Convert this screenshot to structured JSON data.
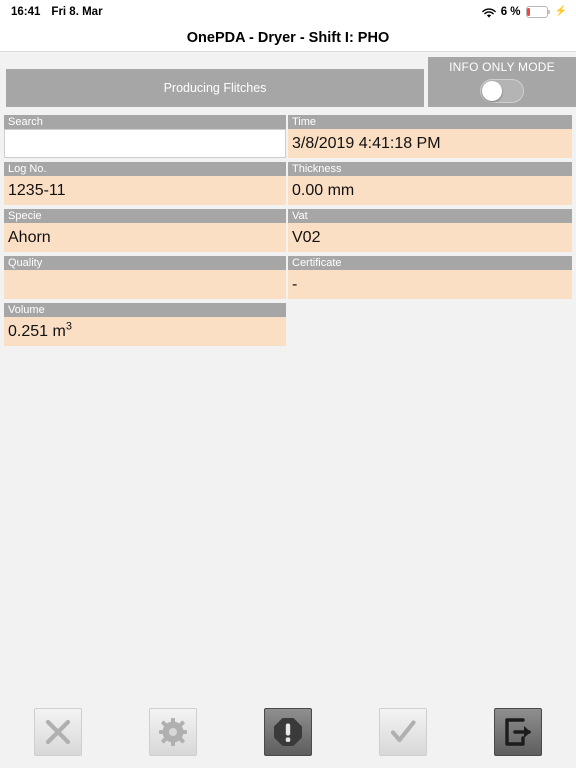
{
  "status_bar": {
    "time": "16:41",
    "date": "Fri 8. Mar",
    "wifi_icon": "wifi-icon",
    "battery_percent": "6 %",
    "battery_level": 6,
    "charging": true,
    "battery_color": "#f5453b"
  },
  "window": {
    "title": "OnePDA - Dryer - Shift I: PHO"
  },
  "topbar": {
    "status_banner": "Producing Flitches",
    "info_only_mode": {
      "label": "INFO ONLY MODE",
      "state": "off"
    }
  },
  "colors": {
    "label_bar": "#a6a6a6",
    "value_cell": "#fbdfc5",
    "page_background": "#f2f2f2",
    "banner": "#a6a6a6"
  },
  "fields": {
    "left": [
      {
        "label": "Search",
        "value": "",
        "placeholder": "",
        "style": "input"
      },
      {
        "label": "Log No.",
        "value": "1235-11",
        "style": "value"
      },
      {
        "label": "Specie",
        "value": "Ahorn",
        "style": "value"
      },
      {
        "label": "Quality",
        "value": "",
        "style": "value"
      },
      {
        "label": "Volume",
        "value": "0.251 m³",
        "style": "value"
      }
    ],
    "right": [
      {
        "label": "Time",
        "value": "3/8/2019 4:41:18 PM",
        "style": "value"
      },
      {
        "label": "Thickness",
        "value": "0.00 mm",
        "style": "value"
      },
      {
        "label": "Vat",
        "value": "V02",
        "style": "value"
      },
      {
        "label": "Certificate",
        "value": "-",
        "style": "value"
      }
    ]
  },
  "toolbar": {
    "buttons": [
      {
        "name": "cancel-button",
        "icon": "x-icon",
        "state": "light"
      },
      {
        "name": "settings-button",
        "icon": "gear-icon",
        "state": "light"
      },
      {
        "name": "alert-button",
        "icon": "warning-icon",
        "state": "dark"
      },
      {
        "name": "confirm-button",
        "icon": "check-icon",
        "state": "light"
      },
      {
        "name": "exit-button",
        "icon": "exit-icon",
        "state": "dark"
      }
    ]
  }
}
